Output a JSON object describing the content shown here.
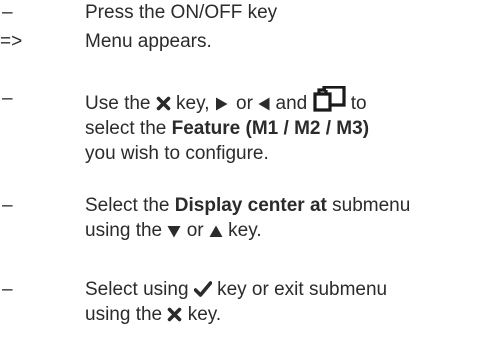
{
  "steps": [
    {
      "marker": "–",
      "lines": [
        "Press the ON/OFF key"
      ]
    },
    {
      "marker": "=>",
      "lines": [
        "Menu appears."
      ]
    },
    {
      "marker": "–",
      "l1_a": "Use the",
      "l1_b": "key,",
      "l1_c": "or",
      "l1_d": "and",
      "l1_e": "to",
      "l2_a": "select the",
      "l2_bold": "Feature (M1 / M2 / M3)",
      "l3": "you wish to configure."
    },
    {
      "marker": "–",
      "l1_a": "Select the",
      "l1_bold": "Display center at",
      "l1_b": "submenu",
      "l2_a": "using the",
      "l2_b": "or",
      "l2_c": "key."
    },
    {
      "marker": "–",
      "l1_a": "Select using",
      "l1_b": "key or exit submenu",
      "l2_a": "using the",
      "l2_b": "key."
    }
  ],
  "icons": {
    "close": "x-icon",
    "right": "triangle-right-icon",
    "left": "triangle-left-icon",
    "pages": "pages-icon",
    "down": "triangle-down-icon",
    "up": "triangle-up-icon",
    "check": "checkmark-icon"
  },
  "colors": {
    "text": "#2b2b2b"
  }
}
